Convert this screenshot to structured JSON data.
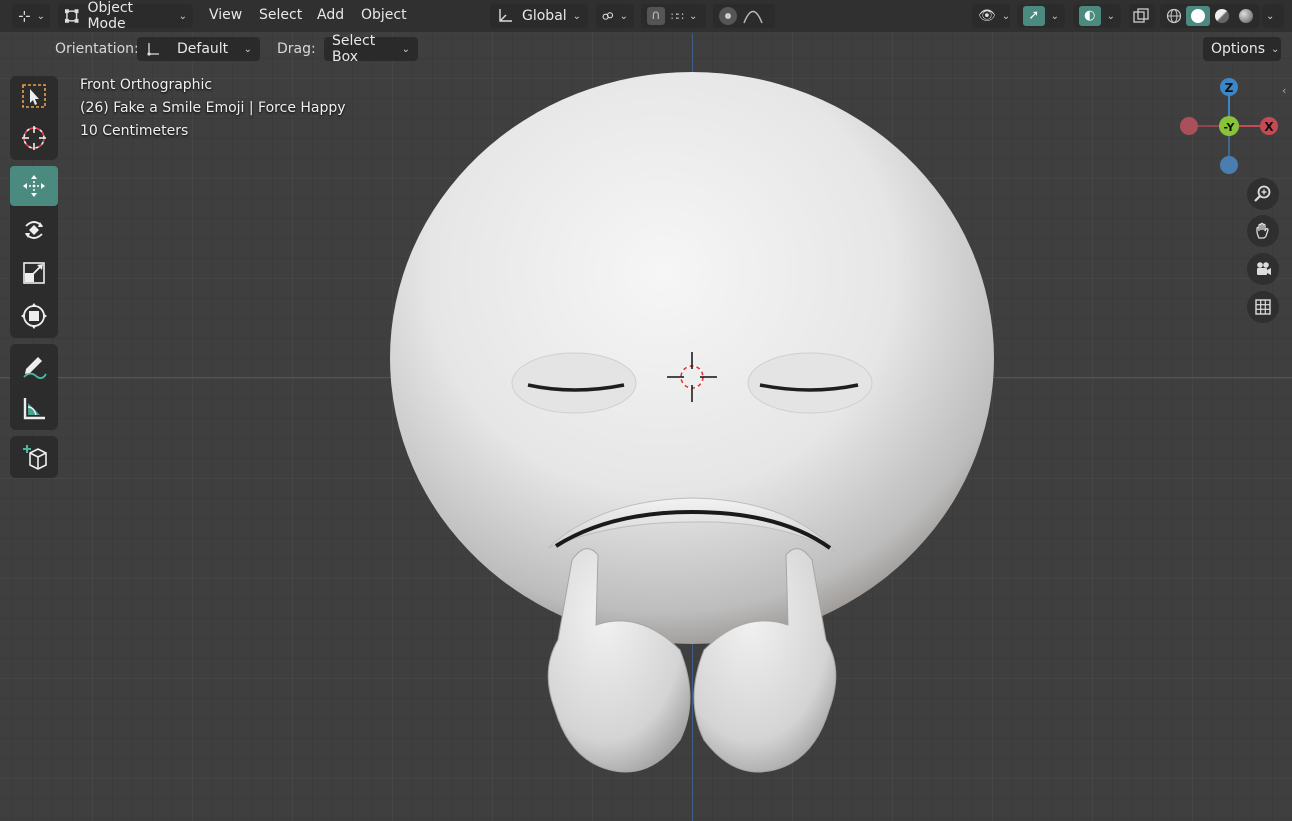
{
  "header": {
    "editor_type_icon": "viewport-editor-icon",
    "mode_label": "Object Mode",
    "menus": [
      "View",
      "Select",
      "Add",
      "Object"
    ],
    "transform_orientation": "Global",
    "colors": {
      "accent": "#4a8a7f",
      "header_bg": "#303030",
      "viewport_bg": "#3f3f3f",
      "x_axis": "#c64a55",
      "y_axis": "#8ac33a",
      "z_axis": "#3d86c8"
    }
  },
  "tool_settings": {
    "orientation_label": "Orientation:",
    "orientation_value": "Default",
    "drag_label": "Drag:",
    "drag_value": "Select Box",
    "options_label": "Options"
  },
  "viewport": {
    "view_name": "Front Orthographic",
    "object_info": "(26) Fake a Smile Emoji | Force Happy",
    "scale_info": "10 Centimeters"
  },
  "gizmo": {
    "z_label": "Z",
    "y_label": "-Y",
    "x_label": "X"
  },
  "toolbar": {
    "tools": [
      "select-box",
      "cursor",
      "move",
      "rotate",
      "scale",
      "transform",
      "annotate",
      "measure",
      "add-cube"
    ],
    "active_tool": "move"
  },
  "nav_buttons": [
    "zoom-icon",
    "pan-hand-icon",
    "camera-icon",
    "grid-view-icon"
  ]
}
